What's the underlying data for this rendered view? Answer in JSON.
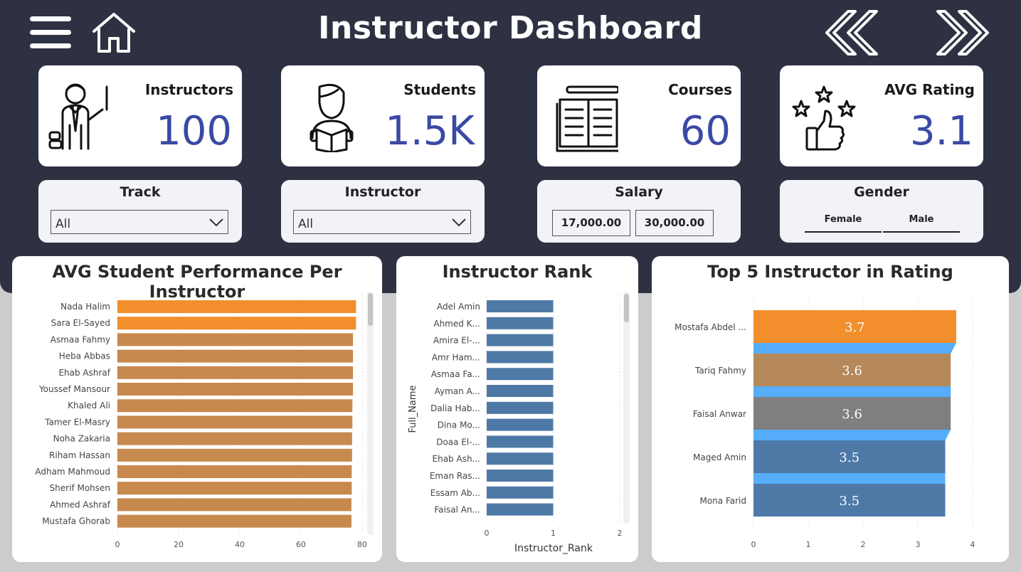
{
  "header": {
    "title": "Instructor Dashboard",
    "icons": [
      "menu-icon",
      "home-icon",
      "back-icon",
      "forward-icon"
    ]
  },
  "kpis": [
    {
      "label": "Instructors",
      "value": "100",
      "icon": "teacher-icon"
    },
    {
      "label": "Students",
      "value": "1.5K",
      "icon": "student-reading-icon"
    },
    {
      "label": "Courses",
      "value": "60",
      "icon": "open-book-icon"
    },
    {
      "label": "AVG Rating",
      "value": "3.1",
      "icon": "rating-thumbs-up-icon"
    }
  ],
  "slicers": {
    "track": {
      "title": "Track",
      "value": "All"
    },
    "instructor": {
      "title": "Instructor",
      "value": "All"
    },
    "salary": {
      "title": "Salary",
      "min": "17,000.00",
      "max": "30,000.00"
    },
    "gender": {
      "title": "Gender",
      "options": [
        "Female",
        "Male"
      ]
    }
  },
  "colors": {
    "header_bg": "#2e3142",
    "kpi_value": "#3a49a4",
    "bar_orange": "#f28e2c",
    "bar_tan": "#c7894e",
    "bar_blue": "#4e79a7",
    "bar_brown": "#b5885a",
    "bar_gray": "#7f7f7f",
    "ribbon_blue": "#56aefa"
  },
  "chart_data": [
    {
      "type": "bar",
      "orientation": "horizontal",
      "title": "AVG Student Performance Per Instructor",
      "categories": [
        "Nada Halim",
        "Sara El-Sayed",
        "Asmaa Fahmy",
        "Heba Abbas",
        "Ehab Ashraf",
        "Youssef Mansour",
        "Khaled Ali",
        "Tamer El-Masry",
        "Noha Zakaria",
        "Riham Hassan",
        "Adham Mahmoud",
        "Sherif Mohsen",
        "Ahmed Ashraf",
        "Mustafa Ghorab"
      ],
      "values": [
        78,
        78,
        77,
        77,
        77,
        77,
        76.8,
        76.8,
        76.7,
        76.7,
        76.6,
        76.6,
        76.5,
        76.5
      ],
      "highlight": [
        "Nada Halim",
        "Sara El-Sayed"
      ],
      "xlim": [
        0,
        80
      ],
      "xticks": [
        "0",
        "20",
        "40",
        "60",
        "80"
      ]
    },
    {
      "type": "bar",
      "orientation": "horizontal",
      "title": "Instructor Rank",
      "xlabel": "Instructor_Rank",
      "ylabel": "Full_Name",
      "categories": [
        "Adel Amin",
        "Ahmed K...",
        "Amira El-...",
        "Amr Ham...",
        "Asmaa Fa...",
        "Ayman A...",
        "Dalia Hab...",
        "Dina Mo...",
        "Doaa El-...",
        "Ehab Ash...",
        "Eman Ras...",
        "Essam Ab...",
        "Faisal An..."
      ],
      "values": [
        1,
        1,
        1,
        1,
        1,
        1,
        1,
        1,
        1,
        1,
        1,
        1,
        1
      ],
      "xlim": [
        0,
        2
      ],
      "xticks": [
        "0",
        "1",
        "2"
      ]
    },
    {
      "type": "bar",
      "orientation": "horizontal",
      "title": "Top 5 Instructor in Rating",
      "categories": [
        "Mostafa Abdel ...",
        "Tariq Fahmy",
        "Faisal Anwar",
        "Maged Amin",
        "Mona Farid"
      ],
      "values": [
        3.7,
        3.6,
        3.6,
        3.5,
        3.5
      ],
      "data_labels": [
        "3.7",
        "3.6",
        "3.6",
        "3.5",
        "3.5"
      ],
      "xlim": [
        0,
        4
      ],
      "xticks": [
        "0",
        "1",
        "2",
        "3",
        "4"
      ]
    }
  ]
}
